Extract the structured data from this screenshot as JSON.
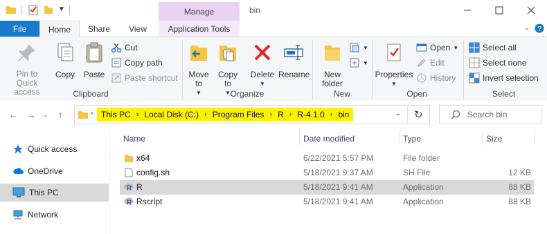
{
  "window": {
    "title": "bin",
    "contextual_group": "Manage"
  },
  "tabs": {
    "file": "File",
    "home": "Home",
    "share": "Share",
    "view": "View",
    "app_tools": "Application Tools"
  },
  "ribbon": {
    "clipboard": {
      "label": "Clipboard",
      "pin": "Pin to Quick access",
      "copy": "Copy",
      "paste": "Paste",
      "cut": "Cut",
      "copy_path": "Copy path",
      "paste_shortcut": "Paste shortcut"
    },
    "organize": {
      "label": "Organize",
      "move_to": "Move to",
      "copy_to": "Copy to",
      "delete": "Delete",
      "rename": "Rename"
    },
    "new": {
      "label": "New",
      "new_folder": "New folder"
    },
    "open": {
      "label": "Open",
      "properties": "Properties",
      "open": "Open",
      "edit": "Edit",
      "history": "History"
    },
    "select": {
      "label": "Select",
      "select_all": "Select all",
      "select_none": "Select none",
      "invert_selection": "Invert selection"
    }
  },
  "address": {
    "crumbs": [
      "This PC",
      "Local Disk (C:)",
      "Program Files",
      "R",
      "R-4.1.0",
      "bin"
    ],
    "highlight_color": "#fff200"
  },
  "search": {
    "placeholder": "Search bin"
  },
  "nav": {
    "quick_access": "Quick access",
    "onedrive": "OneDrive",
    "this_pc": "This PC",
    "network": "Network"
  },
  "columns": {
    "name": "Name",
    "date": "Date modified",
    "type": "Type",
    "size": "Size"
  },
  "files": [
    {
      "name": "x64",
      "date": "6/22/2021 5:57 PM",
      "type": "File folder",
      "size": "",
      "icon": "folder-icon"
    },
    {
      "name": "config.sh",
      "date": "5/18/2021 9:37 AM",
      "type": "SH File",
      "size": "12 KB",
      "icon": "file-icon"
    },
    {
      "name": "R",
      "date": "5/18/2021 9:41 AM",
      "type": "Application",
      "size": "88 KB",
      "icon": "r-app-icon",
      "selected": true
    },
    {
      "name": "Rscript",
      "date": "5/18/2021 9:41 AM",
      "type": "Application",
      "size": "88 KB",
      "icon": "r-app-icon"
    }
  ]
}
